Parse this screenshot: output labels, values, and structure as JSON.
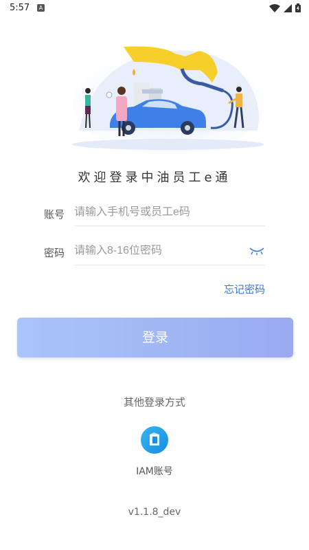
{
  "status": {
    "time": "5:57",
    "notification_glyph": "A"
  },
  "welcome_title": "欢迎登录中油员工e通",
  "account": {
    "label": "账号",
    "placeholder": "请输入手机号或员工e码"
  },
  "password": {
    "label": "密码",
    "placeholder": "请输入8-16位密码"
  },
  "forgot_password": "忘记密码",
  "login_button": "登录",
  "other_login": {
    "title": "其他登录方式",
    "options": [
      {
        "label": "IAM账号",
        "icon": "iam-icon"
      }
    ]
  },
  "version": "v1.1.8_dev",
  "colors": {
    "accent": "#3a78d8",
    "button_start": "#a9c5fa",
    "button_end": "#9aaaf0",
    "icon_blue": "#1a8ee0"
  }
}
